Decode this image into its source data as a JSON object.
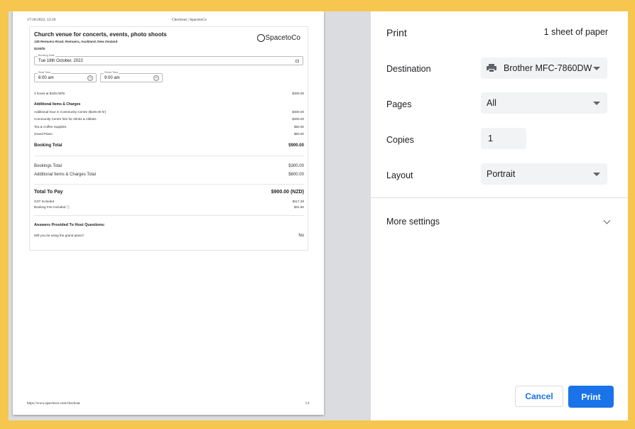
{
  "preview": {
    "header_datetime": "17/10/2022, 13:50",
    "header_title": "Checkout | SpacetoCo",
    "footer_url": "https://www.spacetoco.com/checkout",
    "footer_page": "1/1",
    "venue": {
      "title": "Church venue for concerts, events, photo shoots",
      "address": "138 Remuera Road, Remuera, Auckland, New Zealand",
      "rate": "$100/hr"
    },
    "logo_text": "SpacetoCo",
    "booking_date": {
      "label": "Booking Date",
      "value": "Tue 18th October, 2022"
    },
    "start_time": {
      "label": "Start Time",
      "value": "6:00 am"
    },
    "finish_time": {
      "label": "Finish Time",
      "value": "9:00 am"
    },
    "hours_line": {
      "label": "3 hours at $100.00/hr",
      "amount": "$300.00"
    },
    "additional_title": "Additional Items & Charges",
    "additional_items": [
      {
        "label": "Additional hour in Community Centre ($100.00 hr)",
        "amount": "$300.00"
      },
      {
        "label": "Community Centre hire for drinks & nibbles",
        "amount": "$200.00"
      },
      {
        "label": "Tea & Coffee Supplies",
        "amount": "$50.00"
      },
      {
        "label": "Grand Piano",
        "amount": "$50.00"
      }
    ],
    "booking_total": {
      "label": "Booking Total",
      "amount": "$900.00"
    },
    "bookings_total": {
      "label": "Bookings Total",
      "amount": "$300.00"
    },
    "additional_total": {
      "label": "Additional Items & Charges Total",
      "amount": "$600.00"
    },
    "total_to_pay": {
      "label": "Total To Pay",
      "amount": "$900.00 (NZD)"
    },
    "gst": {
      "label": "GST Included",
      "amount": "$117.39"
    },
    "booking_fee": {
      "label": "Booking Fee Included ⓘ",
      "amount": "$31.50"
    },
    "answers_title": "Answers Provided To Host Questions:",
    "question": {
      "label": "Will you be using the grand piano?",
      "answer": "No"
    }
  },
  "settings": {
    "title": "Print",
    "sheets": "1 sheet of paper",
    "destination_label": "Destination",
    "destination_value": "Brother MFC-7860DW",
    "pages_label": "Pages",
    "pages_value": "All",
    "copies_label": "Copies",
    "copies_value": "1",
    "layout_label": "Layout",
    "layout_value": "Portrait",
    "more_settings": "More settings",
    "cancel": "Cancel",
    "print": "Print"
  }
}
